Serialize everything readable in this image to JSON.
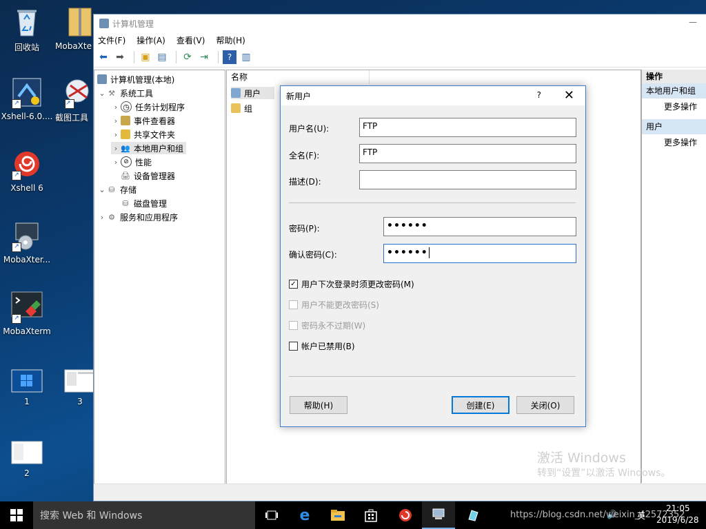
{
  "desktop": {
    "icons": [
      {
        "label": "回收站"
      },
      {
        "label": "MobaXte"
      },
      {
        "label": "Xshell-6.0...."
      },
      {
        "label": "截图工具"
      },
      {
        "label": "Xshell 6"
      },
      {
        "label": "MobaXter..."
      },
      {
        "label": "MobaXterm"
      },
      {
        "label": "1"
      },
      {
        "label": "3"
      },
      {
        "label": "2"
      }
    ]
  },
  "window": {
    "title": "计算机管理",
    "menu": [
      "文件(F)",
      "操作(A)",
      "查看(V)",
      "帮助(H)"
    ],
    "tree": [
      {
        "label": "计算机管理(本地)"
      },
      {
        "label": "系统工具"
      },
      {
        "label": "任务计划程序"
      },
      {
        "label": "事件查看器"
      },
      {
        "label": "共享文件夹"
      },
      {
        "label": "本地用户和组"
      },
      {
        "label": "性能"
      },
      {
        "label": "设备管理器"
      },
      {
        "label": "存储"
      },
      {
        "label": "磁盘管理"
      },
      {
        "label": "服务和应用程序"
      }
    ],
    "list": {
      "column": "名称",
      "items": [
        {
          "label": "用户"
        },
        {
          "label": "组"
        }
      ]
    },
    "actions": {
      "header": "操作",
      "groups": [
        {
          "title": "本地用户和组",
          "item": "更多操作"
        },
        {
          "title": "用户",
          "item": "更多操作"
        }
      ]
    }
  },
  "dialog": {
    "title": "新用户",
    "help_glyph": "?",
    "username_label": "用户名(U):",
    "username_value": "FTP",
    "fullname_label": "全名(F):",
    "fullname_value": "FTP",
    "desc_label": "描述(D):",
    "desc_value": "",
    "password_label": "密码(P):",
    "password_value": "••••••",
    "confirm_label": "确认密码(C):",
    "confirm_value": "••••••",
    "checkboxes": [
      {
        "label": "用户下次登录时须更改密码(M)",
        "checked": true,
        "enabled": true
      },
      {
        "label": "用户不能更改密码(S)",
        "checked": false,
        "enabled": false
      },
      {
        "label": "密码永不过期(W)",
        "checked": false,
        "enabled": false
      },
      {
        "label": "帐户已禁用(B)",
        "checked": false,
        "enabled": true
      }
    ],
    "btn_help": "帮助(H)",
    "btn_create": "创建(E)",
    "btn_close": "关闭(O)"
  },
  "watermark": {
    "line1": "激活 Windows",
    "line2": "转到“设置”以激活 Windows。"
  },
  "taskbar": {
    "search_placeholder": "搜索 Web 和 Windows",
    "ime": "英",
    "time": "21:05",
    "date": "2019/6/28",
    "url_overlay": "https://blog.csdn.net/weixin_42572352"
  },
  "colors": {
    "accent": "#0078d7",
    "desktop_bg": "#0a3a6e",
    "taskbar_bg": "#000000",
    "action_group_bg": "#d7e6f5"
  }
}
